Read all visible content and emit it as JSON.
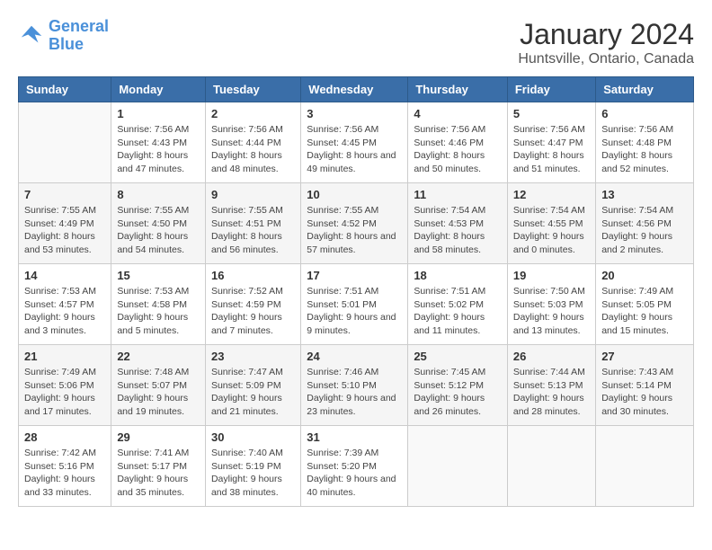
{
  "header": {
    "logo_line1": "General",
    "logo_line2": "Blue",
    "title": "January 2024",
    "subtitle": "Huntsville, Ontario, Canada"
  },
  "days_of_week": [
    "Sunday",
    "Monday",
    "Tuesday",
    "Wednesday",
    "Thursday",
    "Friday",
    "Saturday"
  ],
  "weeks": [
    [
      {
        "day": "",
        "sunrise": "",
        "sunset": "",
        "daylight": ""
      },
      {
        "day": "1",
        "sunrise": "Sunrise: 7:56 AM",
        "sunset": "Sunset: 4:43 PM",
        "daylight": "Daylight: 8 hours and 47 minutes."
      },
      {
        "day": "2",
        "sunrise": "Sunrise: 7:56 AM",
        "sunset": "Sunset: 4:44 PM",
        "daylight": "Daylight: 8 hours and 48 minutes."
      },
      {
        "day": "3",
        "sunrise": "Sunrise: 7:56 AM",
        "sunset": "Sunset: 4:45 PM",
        "daylight": "Daylight: 8 hours and 49 minutes."
      },
      {
        "day": "4",
        "sunrise": "Sunrise: 7:56 AM",
        "sunset": "Sunset: 4:46 PM",
        "daylight": "Daylight: 8 hours and 50 minutes."
      },
      {
        "day": "5",
        "sunrise": "Sunrise: 7:56 AM",
        "sunset": "Sunset: 4:47 PM",
        "daylight": "Daylight: 8 hours and 51 minutes."
      },
      {
        "day": "6",
        "sunrise": "Sunrise: 7:56 AM",
        "sunset": "Sunset: 4:48 PM",
        "daylight": "Daylight: 8 hours and 52 minutes."
      }
    ],
    [
      {
        "day": "7",
        "sunrise": "Sunrise: 7:55 AM",
        "sunset": "Sunset: 4:49 PM",
        "daylight": "Daylight: 8 hours and 53 minutes."
      },
      {
        "day": "8",
        "sunrise": "Sunrise: 7:55 AM",
        "sunset": "Sunset: 4:50 PM",
        "daylight": "Daylight: 8 hours and 54 minutes."
      },
      {
        "day": "9",
        "sunrise": "Sunrise: 7:55 AM",
        "sunset": "Sunset: 4:51 PM",
        "daylight": "Daylight: 8 hours and 56 minutes."
      },
      {
        "day": "10",
        "sunrise": "Sunrise: 7:55 AM",
        "sunset": "Sunset: 4:52 PM",
        "daylight": "Daylight: 8 hours and 57 minutes."
      },
      {
        "day": "11",
        "sunrise": "Sunrise: 7:54 AM",
        "sunset": "Sunset: 4:53 PM",
        "daylight": "Daylight: 8 hours and 58 minutes."
      },
      {
        "day": "12",
        "sunrise": "Sunrise: 7:54 AM",
        "sunset": "Sunset: 4:55 PM",
        "daylight": "Daylight: 9 hours and 0 minutes."
      },
      {
        "day": "13",
        "sunrise": "Sunrise: 7:54 AM",
        "sunset": "Sunset: 4:56 PM",
        "daylight": "Daylight: 9 hours and 2 minutes."
      }
    ],
    [
      {
        "day": "14",
        "sunrise": "Sunrise: 7:53 AM",
        "sunset": "Sunset: 4:57 PM",
        "daylight": "Daylight: 9 hours and 3 minutes."
      },
      {
        "day": "15",
        "sunrise": "Sunrise: 7:53 AM",
        "sunset": "Sunset: 4:58 PM",
        "daylight": "Daylight: 9 hours and 5 minutes."
      },
      {
        "day": "16",
        "sunrise": "Sunrise: 7:52 AM",
        "sunset": "Sunset: 4:59 PM",
        "daylight": "Daylight: 9 hours and 7 minutes."
      },
      {
        "day": "17",
        "sunrise": "Sunrise: 7:51 AM",
        "sunset": "Sunset: 5:01 PM",
        "daylight": "Daylight: 9 hours and 9 minutes."
      },
      {
        "day": "18",
        "sunrise": "Sunrise: 7:51 AM",
        "sunset": "Sunset: 5:02 PM",
        "daylight": "Daylight: 9 hours and 11 minutes."
      },
      {
        "day": "19",
        "sunrise": "Sunrise: 7:50 AM",
        "sunset": "Sunset: 5:03 PM",
        "daylight": "Daylight: 9 hours and 13 minutes."
      },
      {
        "day": "20",
        "sunrise": "Sunrise: 7:49 AM",
        "sunset": "Sunset: 5:05 PM",
        "daylight": "Daylight: 9 hours and 15 minutes."
      }
    ],
    [
      {
        "day": "21",
        "sunrise": "Sunrise: 7:49 AM",
        "sunset": "Sunset: 5:06 PM",
        "daylight": "Daylight: 9 hours and 17 minutes."
      },
      {
        "day": "22",
        "sunrise": "Sunrise: 7:48 AM",
        "sunset": "Sunset: 5:07 PM",
        "daylight": "Daylight: 9 hours and 19 minutes."
      },
      {
        "day": "23",
        "sunrise": "Sunrise: 7:47 AM",
        "sunset": "Sunset: 5:09 PM",
        "daylight": "Daylight: 9 hours and 21 minutes."
      },
      {
        "day": "24",
        "sunrise": "Sunrise: 7:46 AM",
        "sunset": "Sunset: 5:10 PM",
        "daylight": "Daylight: 9 hours and 23 minutes."
      },
      {
        "day": "25",
        "sunrise": "Sunrise: 7:45 AM",
        "sunset": "Sunset: 5:12 PM",
        "daylight": "Daylight: 9 hours and 26 minutes."
      },
      {
        "day": "26",
        "sunrise": "Sunrise: 7:44 AM",
        "sunset": "Sunset: 5:13 PM",
        "daylight": "Daylight: 9 hours and 28 minutes."
      },
      {
        "day": "27",
        "sunrise": "Sunrise: 7:43 AM",
        "sunset": "Sunset: 5:14 PM",
        "daylight": "Daylight: 9 hours and 30 minutes."
      }
    ],
    [
      {
        "day": "28",
        "sunrise": "Sunrise: 7:42 AM",
        "sunset": "Sunset: 5:16 PM",
        "daylight": "Daylight: 9 hours and 33 minutes."
      },
      {
        "day": "29",
        "sunrise": "Sunrise: 7:41 AM",
        "sunset": "Sunset: 5:17 PM",
        "daylight": "Daylight: 9 hours and 35 minutes."
      },
      {
        "day": "30",
        "sunrise": "Sunrise: 7:40 AM",
        "sunset": "Sunset: 5:19 PM",
        "daylight": "Daylight: 9 hours and 38 minutes."
      },
      {
        "day": "31",
        "sunrise": "Sunrise: 7:39 AM",
        "sunset": "Sunset: 5:20 PM",
        "daylight": "Daylight: 9 hours and 40 minutes."
      },
      {
        "day": "",
        "sunrise": "",
        "sunset": "",
        "daylight": ""
      },
      {
        "day": "",
        "sunrise": "",
        "sunset": "",
        "daylight": ""
      },
      {
        "day": "",
        "sunrise": "",
        "sunset": "",
        "daylight": ""
      }
    ]
  ]
}
